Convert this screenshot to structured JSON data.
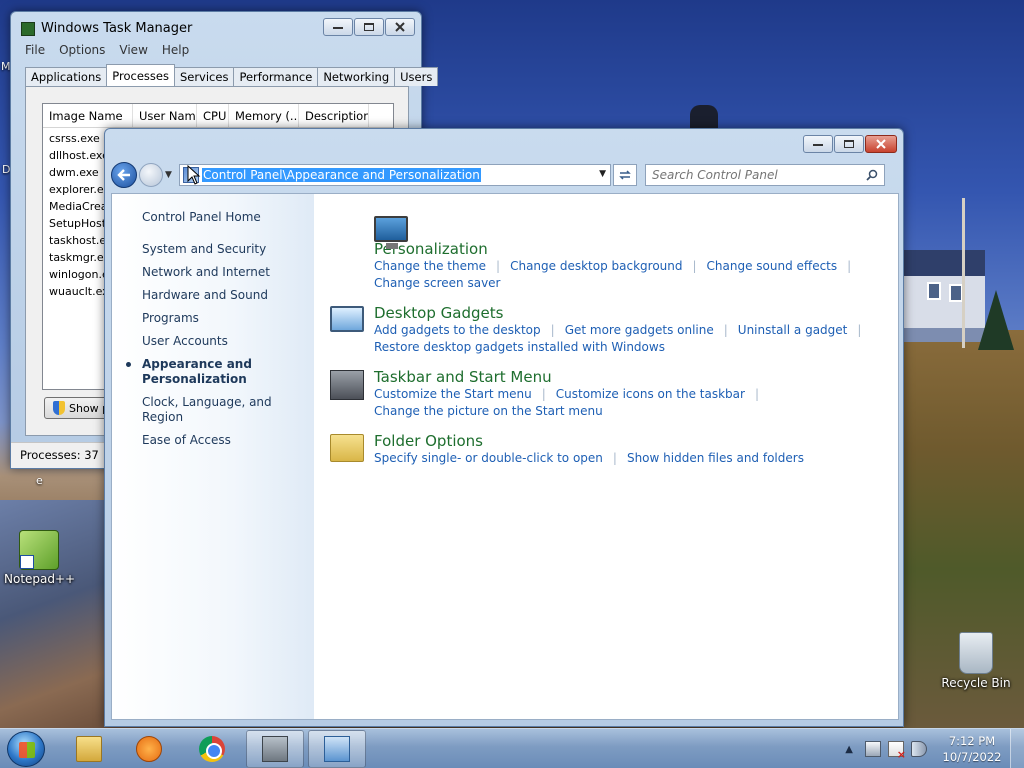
{
  "desktop": {
    "icons": [
      {
        "label": "Notepad++"
      },
      {
        "label": "Recycle Bin"
      }
    ],
    "edge_fragments": [
      "M",
      "D",
      "e"
    ]
  },
  "task_manager": {
    "title": "Windows Task Manager",
    "menu": [
      "File",
      "Options",
      "View",
      "Help"
    ],
    "tabs": [
      "Applications",
      "Processes",
      "Services",
      "Performance",
      "Networking",
      "Users"
    ],
    "active_tab": "Processes",
    "columns": [
      "Image Name",
      "User Name",
      "CPU",
      "Memory (...",
      "Description"
    ],
    "processes": [
      "csrss.exe",
      "dllhost.exe",
      "dwm.exe",
      "explorer.ex",
      "MediaCreat",
      "SetupHost.e",
      "taskhost.ex",
      "taskmgr.ex",
      "winlogon.ex",
      "wuauclt.exe"
    ],
    "show_button_label": "Show p",
    "status": "Processes: 37"
  },
  "control_panel": {
    "address": "Control Panel\\Appearance and Personalization",
    "search_placeholder": "Search Control Panel",
    "left_home": "Control Panel Home",
    "left_items": [
      "System and Security",
      "Network and Internet",
      "Hardware and Sound",
      "Programs",
      "User Accounts",
      "Appearance and Personalization",
      "Clock, Language, and Region",
      "Ease of Access"
    ],
    "current_item": "Appearance and Personalization",
    "categories": [
      {
        "title": "Personalization",
        "icon": "personalization-icon",
        "rows": [
          [
            "Change the theme",
            "Change desktop background",
            "Change sound effects"
          ],
          [
            "Change screen saver"
          ]
        ]
      },
      {
        "title": "Desktop Gadgets",
        "icon": "gadgets-icon",
        "rows": [
          [
            "Add gadgets to the desktop",
            "Get more gadgets online",
            "Uninstall a gadget"
          ],
          [
            "Restore desktop gadgets installed with Windows"
          ]
        ]
      },
      {
        "title": "Taskbar and Start Menu",
        "icon": "taskbar-icon",
        "rows": [
          [
            "Customize the Start menu",
            "Customize icons on the taskbar"
          ],
          [
            "Change the picture on the Start menu"
          ]
        ]
      },
      {
        "title": "Folder Options",
        "icon": "folder-options-icon",
        "rows": [
          [
            "Specify single- or double-click to open",
            "Show hidden files and folders"
          ]
        ]
      }
    ]
  },
  "taskbar": {
    "pinned": [
      "windows-explorer-icon",
      "media-player-icon",
      "chrome-icon",
      "task-manager-icon",
      "control-panel-icon"
    ],
    "clock_time": "7:12 PM",
    "clock_date": "10/7/2022"
  }
}
